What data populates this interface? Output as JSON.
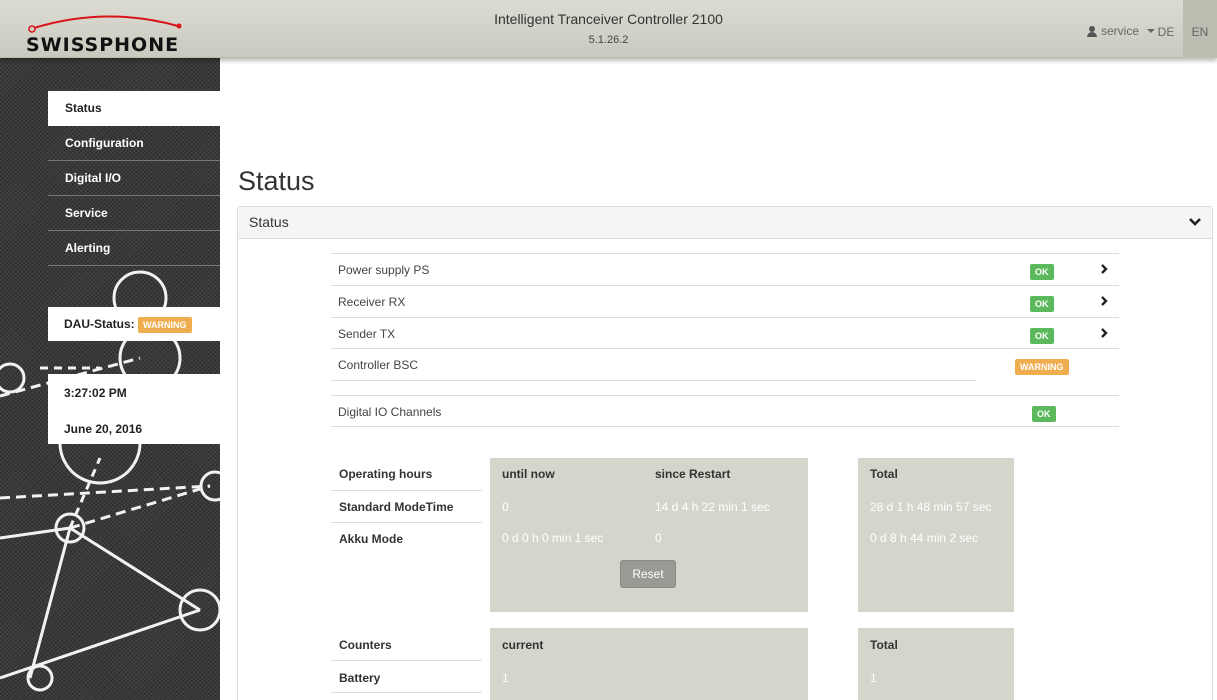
{
  "header": {
    "brand": "SWISSPHONE",
    "title": "Intelligent Tranceiver Controller 2100",
    "version": "5.1.26.2",
    "user": "service",
    "languages": [
      "DE",
      "EN"
    ],
    "active_language": "EN"
  },
  "sidebar": {
    "items": [
      {
        "label": "Status",
        "active": true
      },
      {
        "label": "Configuration",
        "active": false
      },
      {
        "label": "Digital I/O",
        "active": false
      },
      {
        "label": "Service",
        "active": false
      },
      {
        "label": "Alerting",
        "active": false
      }
    ],
    "dau_status_label": "DAU-Status:",
    "dau_status_value": "WARNING",
    "time": "3:27:02 PM",
    "date": "June 20, 2016"
  },
  "main": {
    "page_title": "Status",
    "panel_title": "Status",
    "status_rows": [
      {
        "label": "Power supply PS",
        "status": "OK",
        "expandable": true
      },
      {
        "label": "Receiver RX",
        "status": "OK",
        "expandable": true
      },
      {
        "label": "Sender TX",
        "status": "OK",
        "expandable": true
      },
      {
        "label": "Controller BSC",
        "status": "WARNING",
        "expandable": false
      },
      {
        "label": "Digital IO Channels",
        "status": "OK",
        "expandable": false
      }
    ],
    "operating_hours": {
      "header": "Operating hours",
      "col_until_now": "until now",
      "col_since_restart": "since Restart",
      "col_total": "Total",
      "rows": [
        {
          "label": "Standard ModeTime",
          "until_now": "0",
          "since_restart": "14 d 4 h 22 min 1 sec",
          "total": "28 d 1 h 48 min 57 sec"
        },
        {
          "label": "Akku Mode",
          "until_now": "0 d 0 h 0 min 1 sec",
          "since_restart": "0",
          "total": "0 d 8 h 44 min 2 sec"
        }
      ],
      "reset_label": "Reset"
    },
    "counters": {
      "header": "Counters",
      "col_current": "current",
      "col_total": "Total",
      "rows": [
        {
          "label": "Battery",
          "current": "1",
          "total": "1"
        }
      ]
    }
  },
  "colors": {
    "ok": "#5cb85c",
    "warning": "#f0ad4e",
    "header_bg": "#d3d3c9",
    "table_bg": "#d6d5cc"
  }
}
